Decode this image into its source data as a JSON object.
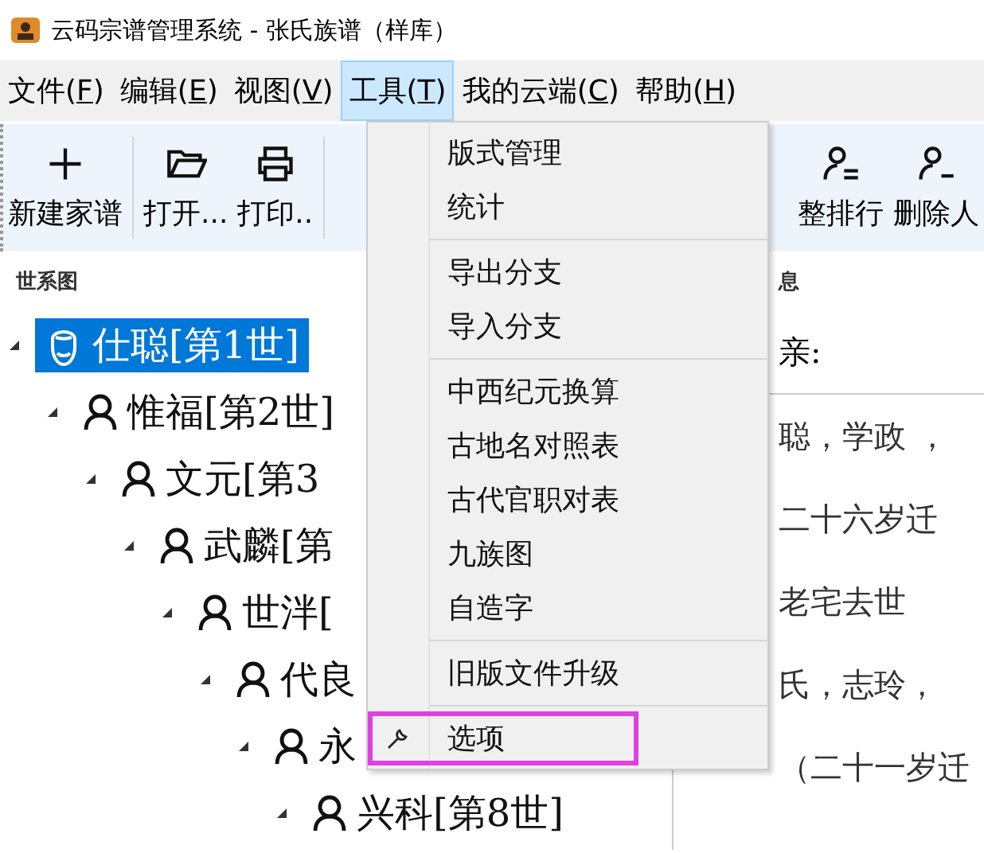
{
  "window": {
    "title": "云码宗谱管理系统 - 张氏族谱（样库）"
  },
  "menubar": [
    {
      "label": "文件(",
      "key": "F",
      "close": ")",
      "selected": false
    },
    {
      "label": "编辑(",
      "key": "E",
      "close": ")",
      "selected": false
    },
    {
      "label": "视图(",
      "key": "V",
      "close": ")",
      "selected": false
    },
    {
      "label": "工具(",
      "key": "T",
      "close": ")",
      "selected": true
    },
    {
      "label": "我的云端(",
      "key": "C",
      "close": ")",
      "selected": false
    },
    {
      "label": "帮助(",
      "key": "H",
      "close": ")",
      "selected": false
    }
  ],
  "toolbar_left": [
    {
      "kind": "plus",
      "label": "新建家谱"
    },
    {
      "kind": "folder",
      "label": "打开..."
    },
    {
      "kind": "printer",
      "label": "打印.."
    }
  ],
  "toolbar_right": [
    {
      "kind": "person-swap",
      "label": "整排行"
    },
    {
      "kind": "person-minus",
      "label": "删除人"
    }
  ],
  "tree_panel": {
    "title": "世系图"
  },
  "info_panel": {
    "title": "息",
    "father_label": "亲:",
    "lines": [
      "聪，学政 ，",
      "二十六岁迁",
      "老宅去世",
      "氏，志玲，",
      "（二十一岁迁"
    ]
  },
  "tree": [
    {
      "kind": "portrait",
      "label": "仕聪[第1世]",
      "selected": true,
      "children": [
        {
          "kind": "person",
          "label": "惟福[第2世]",
          "selected": false,
          "children": [
            {
              "kind": "person",
              "label": "文元[第3",
              "selected": false,
              "children": [
                {
                  "kind": "person",
                  "label": "武麟[第",
                  "selected": false,
                  "children": [
                    {
                      "kind": "person",
                      "label": "世泮[",
                      "selected": false,
                      "children": [
                        {
                          "kind": "person",
                          "label": "代良",
                          "selected": false,
                          "children": [
                            {
                              "kind": "person",
                              "label": "永",
                              "selected": false,
                              "children": [
                                {
                                  "kind": "person",
                                  "label": "兴科[第8世]",
                                  "selected": false
                                }
                              ]
                            }
                          ]
                        }
                      ]
                    }
                  ]
                }
              ]
            }
          ]
        }
      ]
    }
  ],
  "menu_groups": [
    [
      {
        "kind": "plain",
        "label": "版式管理",
        "selected": false
      },
      {
        "kind": "plain",
        "label": "统计",
        "selected": false
      }
    ],
    [
      {
        "kind": "plain",
        "label": "导出分支",
        "selected": false
      },
      {
        "kind": "plain",
        "label": "导入分支",
        "selected": false
      }
    ],
    [
      {
        "kind": "plain",
        "label": "中西纪元换算",
        "selected": false
      },
      {
        "kind": "plain",
        "label": "古地名对照表",
        "selected": false
      },
      {
        "kind": "plain",
        "label": "古代官职对表",
        "selected": false
      },
      {
        "kind": "plain",
        "label": "九族图",
        "selected": false
      },
      {
        "kind": "plain",
        "label": "自造字",
        "selected": false
      }
    ],
    [
      {
        "kind": "plain",
        "label": "旧版文件升级",
        "selected": false
      }
    ],
    [
      {
        "kind": "wrench",
        "label": "选项",
        "selected": true
      }
    ]
  ]
}
